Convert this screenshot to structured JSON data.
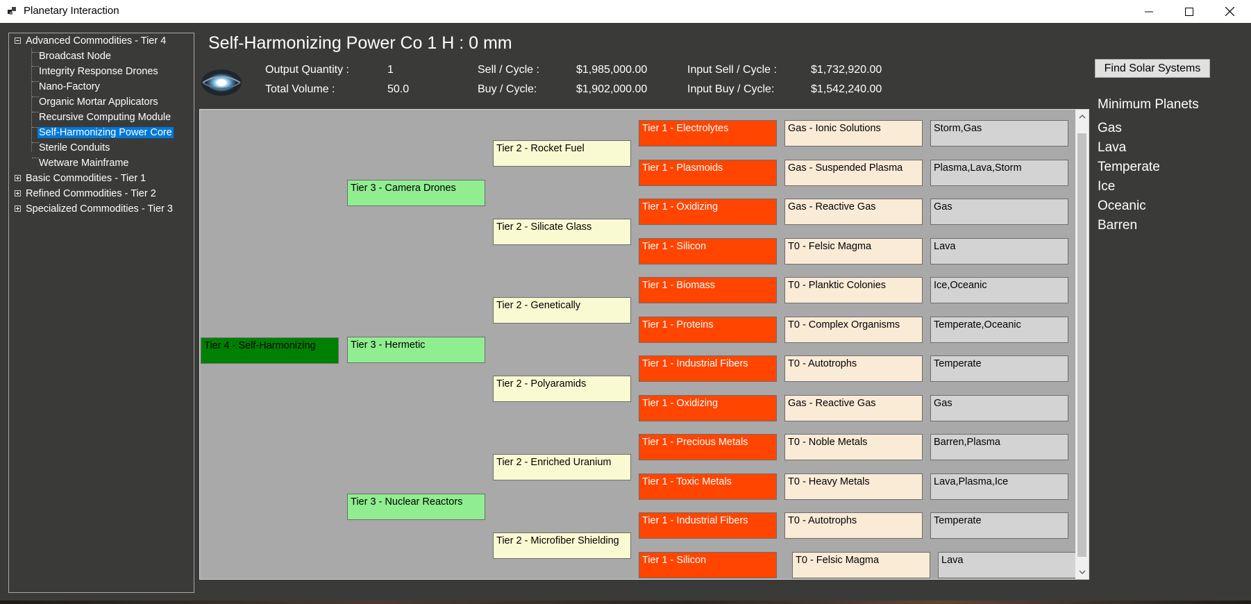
{
  "window": {
    "title": "Planetary Interaction"
  },
  "tree": {
    "groups": [
      {
        "label": "Advanced Commodities - Tier 4",
        "expanded": true
      },
      {
        "label": "Basic Commodities - Tier 1",
        "expanded": false
      },
      {
        "label": "Refined Commodities - Tier 2",
        "expanded": false
      },
      {
        "label": "Specialized Commodities - Tier 3",
        "expanded": false
      }
    ],
    "items": [
      "Broadcast Node",
      "Integrity Response Drones",
      "Nano-Factory",
      "Organic Mortar Applicators",
      "Recursive Computing Module",
      "Self-Harmonizing Power Core",
      "Sterile Conduits",
      "Wetware Mainframe"
    ],
    "selected": "Self-Harmonizing Power Core"
  },
  "header": {
    "title": "Self-Harmonizing Power Co 1 H : 0 mm",
    "output_quantity_label": "Output Quantity :",
    "output_quantity": "1",
    "total_volume_label": "Total Volume :",
    "total_volume": "50.0",
    "sell_cycle_label": "Sell / Cycle :",
    "sell_cycle": "$1,985,000.00",
    "buy_cycle_label": "Buy / Cycle:",
    "buy_cycle": "$1,902,000.00",
    "input_sell_label": "Input Sell / Cycle :",
    "input_sell": "$1,732,920.00",
    "input_buy_label": "Input Buy / Cycle:",
    "input_buy": "$1,542,240.00"
  },
  "actions": {
    "find_solar_systems": "Find Solar Systems"
  },
  "minimum_planets": {
    "heading": "Minimum Planets",
    "planets": [
      "Gas",
      "Lava",
      "Temperate",
      "Ice",
      "Oceanic",
      "Barren"
    ]
  },
  "chain": {
    "tier4": "Tier 4 - Self-Harmonizing",
    "tier3": [
      "Tier 3 - Camera Drones",
      "Tier 3 - Hermetic",
      "Tier 3 - Nuclear Reactors"
    ],
    "tier2": [
      "Tier 2 - Rocket Fuel",
      "Tier 2 - Silicate Glass",
      "Tier 2 - Genetically",
      "Tier 2 - Polyaramids",
      "Tier 2 - Enriched Uranium",
      "Tier 2 - Microfiber Shielding"
    ],
    "tier1": [
      "Tier 1 - Electrolytes",
      "Tier 1 - Plasmoids",
      "Tier 1 - Oxidizing",
      "Tier 1 - Silicon",
      "Tier 1 - Biomass",
      "Tier 1 - Proteins",
      "Tier 1 - Industrial Fibers",
      "Tier 1 - Oxidizing",
      "Tier 1 - Precious Metals",
      "Tier 1 - Toxic Metals",
      "Tier 1 - Industrial Fibers",
      "Tier 1 - Silicon"
    ],
    "tier0": [
      "Gas - Ionic Solutions",
      "Gas - Suspended Plasma",
      "Gas - Reactive Gas",
      "T0 - Felsic Magma",
      "T0 - Planktic Colonies",
      "T0 - Complex Organisms",
      "T0 - Autotrophs",
      "Gas - Reactive Gas",
      "T0 - Noble Metals",
      "T0 - Heavy Metals",
      "T0 - Autotrophs",
      "T0 - Felsic Magma"
    ],
    "planets": [
      "Storm,Gas",
      "Plasma,Lava,Storm",
      "Gas",
      "Lava",
      "Ice,Oceanic",
      "Temperate,Oceanic",
      "Temperate",
      "Gas",
      "Barren,Plasma",
      "Lava,Plasma,Ice",
      "Temperate",
      "Lava"
    ]
  },
  "colors": {
    "tier4": "#008000",
    "tier3": "#90ee90",
    "tier2": "#fafad2",
    "tier1": "#ff4500",
    "tier0": "#faebd7",
    "planet": "#d3d3d3",
    "selection": "#0078d7",
    "background": "#3a3b39",
    "canvas": "#a9a9a9"
  },
  "icons": [
    "app-icon",
    "minimize-icon",
    "maximize-icon",
    "close-icon",
    "collapse-icon",
    "expand-icon",
    "power-core-icon",
    "scroll-up-icon",
    "scroll-down-icon"
  ]
}
